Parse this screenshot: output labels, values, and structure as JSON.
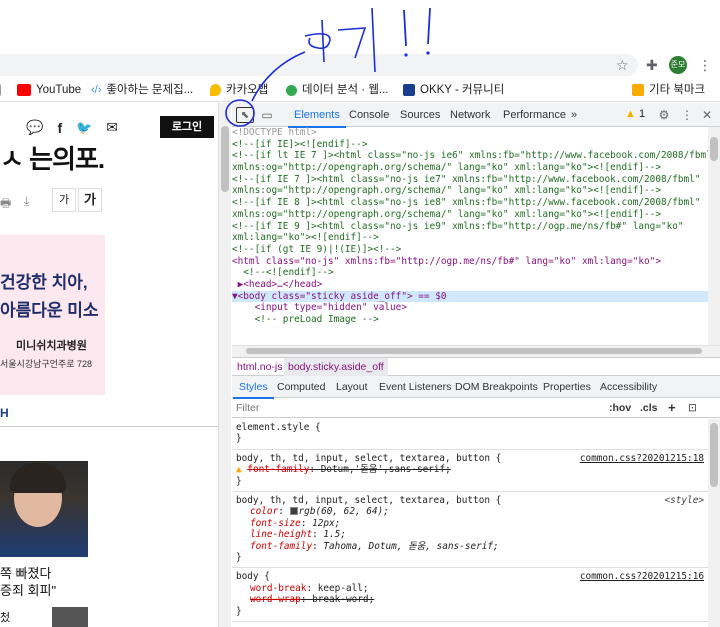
{
  "bookmarks": [
    {
      "label": "YouTube",
      "color": "#ff0000"
    },
    {
      "label": "좋아하는 문제집...",
      "color": "#4285f4"
    },
    {
      "label": "카카오맵",
      "color": "#fbbc04"
    },
    {
      "label": "데이터 분석 · 웹...",
      "color": "#34a853"
    },
    {
      "label": "OKKY - 커뮤니티",
      "color": "#1a3d8f"
    },
    {
      "label": "기타 북마크",
      "color": "#f9ab00"
    }
  ],
  "profile_initials": "준모",
  "webpage": {
    "login_label": "로그인",
    "headline_fragment": "ㅅ 는의포.",
    "font_small": "가",
    "font_large": "가",
    "ad": {
      "line1": "건강한 치아,",
      "line2": "아름다운 미소",
      "clinic": "미니쉬치과병원",
      "address": "서울시강남구언주로 728"
    },
    "section_heading": "H",
    "news_line1": "쪽 빠졌다",
    "news_line2": "증죄 회피\"",
    "news_small": "첬"
  },
  "devtools": {
    "tabs": [
      "Elements",
      "Console",
      "Sources",
      "Network",
      "Performance"
    ],
    "more": "»",
    "warnings": "1",
    "code_lines": [
      {
        "t": "<!DOCTYPE html>",
        "k": "gray"
      },
      {
        "t": "<!--[if IE]><![endif]-->",
        "k": "cm"
      },
      {
        "t": "<!--[if lt IE 7 ]><html class=\"no-js ie6\" xmlns:fb=\"http://www.facebook.com/2008/fbml\"",
        "k": "cm"
      },
      {
        "t": "xmlns:og=\"http://opengraph.org/schema/\" lang=\"ko\" xml:lang=\"ko\"><![endif]-->",
        "k": "cm"
      },
      {
        "t": "<!--[if IE 7 ]><html class=\"no-js ie7\" xmlns:fb=\"http://www.facebook.com/2008/fbml\"",
        "k": "cm"
      },
      {
        "t": "xmlns:og=\"http://opengraph.org/schema/\" lang=\"ko\" xml:lang=\"ko\"><![endif]-->",
        "k": "cm"
      },
      {
        "t": "<!--[if IE 8 ]><html class=\"no-js ie8\" xmlns:fb=\"http://www.facebook.com/2008/fbml\"",
        "k": "cm"
      },
      {
        "t": "xmlns:og=\"http://opengraph.org/schema/\" lang=\"ko\" xml:lang=\"ko\"><![endif]-->",
        "k": "cm"
      },
      {
        "t": "<!--[if IE 9 ]><html class=\"no-js ie9\" xmlns:fb=\"http://ogp.me/ns/fb#\" lang=\"ko\"",
        "k": "cm"
      },
      {
        "t": "xml:lang=\"ko\"><![endif]-->",
        "k": "cm"
      },
      {
        "t": "<!--[if (gt IE 9)|!(IE)]><!-->",
        "k": "cm"
      },
      {
        "t": "<html class=\"no-js\" xmlns:fb=\"http://ogp.me/ns/fb#\" lang=\"ko\" xml:lang=\"ko\">",
        "k": "tag"
      },
      {
        "t": "  <!--<![endif]-->",
        "k": "cm"
      },
      {
        "t": " ▶<head>…</head>",
        "k": "tag"
      },
      {
        "t": "▼<body class=\"sticky aside_off\"> == $0",
        "k": "tagsel"
      },
      {
        "t": "    <input type=\"hidden\" value>",
        "k": "tag"
      },
      {
        "t": "    <!-- preLoad Image -->",
        "k": "cm"
      }
    ],
    "breadcrumbs": [
      "html.no-js",
      "body.sticky.aside_off"
    ],
    "sub_tabs": [
      "Styles",
      "Computed",
      "Layout",
      "Event Listeners",
      "DOM Breakpoints",
      "Properties",
      "Accessibility"
    ],
    "filter_placeholder": "Filter",
    "filter_hov": ":hov",
    "filter_cls": ".cls",
    "filter_plus": "+",
    "rules": [
      {
        "selector": "element.style {",
        "source": "",
        "lines": [],
        "close": "}"
      },
      {
        "selector": "body, th, td, input, select, textarea, button {",
        "source": "common.css?20201215:18",
        "lines": [
          {
            "text": "font-family: Dotum,'돋움',sans-serif;",
            "strike": true,
            "warn": true
          }
        ],
        "close": "}"
      },
      {
        "selector": "body, th, td, input, select, textarea, button {",
        "source": "<style>",
        "lines": [
          {
            "text": "color: rgb(60, 62, 64);",
            "swatch": true
          },
          {
            "text": "font-size: 12px;"
          },
          {
            "text": "line-height: 1.5;"
          },
          {
            "text": "font-family: Tahoma, Dotum, 돋움, sans-serif;"
          }
        ],
        "close": "}"
      },
      {
        "selector": "body {",
        "source": "common.css?20201215:16",
        "lines": [
          {
            "text": "word-break: keep-all;"
          },
          {
            "text": "word-wrap: break-word;",
            "strike": true
          }
        ],
        "close": "}"
      }
    ]
  },
  "annotation_text": "여기!!"
}
